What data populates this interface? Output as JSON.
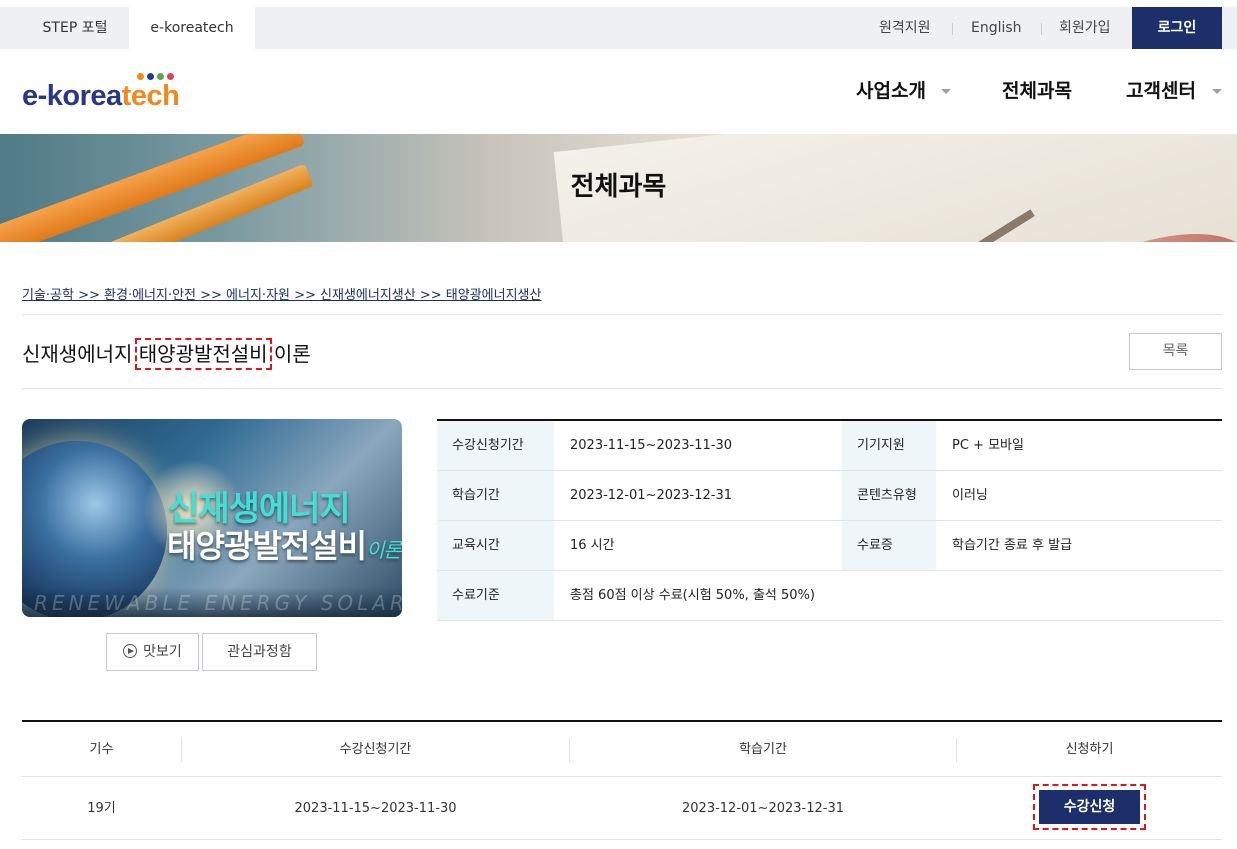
{
  "topbar": {
    "portal_tabs": [
      "STEP 포털",
      "e-koreatech"
    ],
    "links": [
      "원격지원",
      "English",
      "회원가입"
    ],
    "login_label": "로그인"
  },
  "header": {
    "logo": {
      "part1": "e-korea",
      "part2": "tech",
      "dot_colors": [
        "#f08a1c",
        "#27378a",
        "#5aa84a",
        "#e0415a"
      ]
    },
    "nav": [
      "사업소개",
      "전체과목",
      "고객센터"
    ]
  },
  "banner": {
    "title": "전체과목"
  },
  "breadcrumb": "기술·공학 >> 환경·에너지·안전 >> 에너지·자원 >> 신재생에너지생산 >> 태양광에너지생산",
  "course": {
    "title_pre": "신재생에너지 ",
    "title_highlight": "태양광발전설비",
    "title_post": " 이론",
    "list_button": "목록",
    "thumbnail": {
      "line1": "신재생에너지",
      "line2": "태양광발전설비",
      "line2_small": "이론",
      "footer": "RENEWABLE ENERGY SOLAR"
    },
    "preview_button": "맛보기",
    "wishlist_button": "관심과정함"
  },
  "info": {
    "rows": [
      {
        "th1": "수강신청기간",
        "td1": "2023-11-15~2023-11-30",
        "th2": "기기지원",
        "td2": "PC + 모바일"
      },
      {
        "th1": "학습기간",
        "td1": "2023-12-01~2023-12-31",
        "th2": "콘텐츠유형",
        "td2": "이러닝"
      },
      {
        "th1": "교육시간",
        "td1": "16 시간",
        "th2": "수료증",
        "td2": "학습기간 종료 후 발급"
      },
      {
        "th1": "수료기준",
        "td1": "총점 60점 이상 수료(시험 50%, 출석 50%)"
      }
    ]
  },
  "sessions": {
    "headers": [
      "기수",
      "수강신청기간",
      "학습기간",
      "신청하기"
    ],
    "rows": [
      {
        "cohort": "19기",
        "apply_period": "2023-11-15~2023-11-30",
        "study_period": "2023-12-01~2023-12-31",
        "action": "수강신청"
      }
    ]
  },
  "colors": {
    "primary_navy": "#1d2f6b",
    "header_cell_bg": "#eef6f9",
    "highlight_dash": "#e0151b"
  }
}
